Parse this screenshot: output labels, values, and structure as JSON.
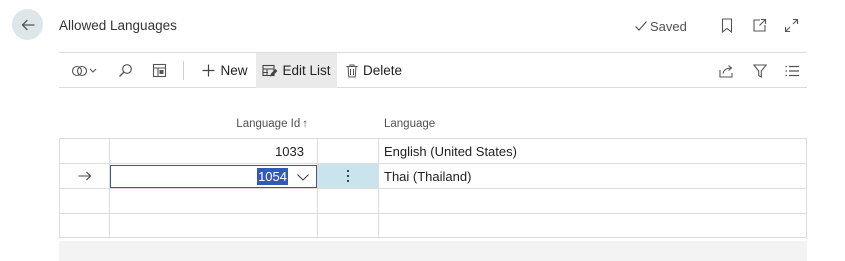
{
  "header": {
    "title": "Allowed Languages",
    "status": "Saved"
  },
  "toolbar": {
    "new_label": "New",
    "edit_list_label": "Edit List",
    "delete_label": "Delete"
  },
  "table": {
    "columns": [
      "Language Id",
      "Language"
    ],
    "sort_indicator": "↑",
    "rows": [
      {
        "language_id": "1033",
        "language": "English (United States)"
      },
      {
        "language_id": "1054",
        "language": "Thai (Thailand)"
      }
    ]
  },
  "colors": {
    "accent": "#2f5bb7",
    "selected_cell": "#c9e4ec",
    "back_button_bg": "#dde7ea"
  }
}
